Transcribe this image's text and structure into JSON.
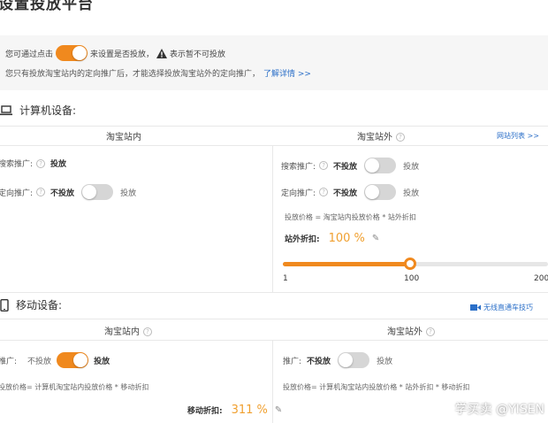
{
  "page_title": "设置投放平台",
  "notice": {
    "line1_prefix": "您可通过点击",
    "line1_mid": "来设置是否投放，",
    "line1_suffix": "表示暂不可投放",
    "line2": "您只有投放淘宝站内的定向推广后，才能选择投放淘宝站外的定向推广，",
    "link": "了解详情 >>"
  },
  "computer": {
    "title": "计算机设备:",
    "inside_header": "淘宝站内",
    "outside_header": "淘宝站外",
    "site_list_link": "网站列表 >>",
    "inside_rows": [
      {
        "label": "搜索推广:",
        "state": "投放"
      },
      {
        "label": "定向推广:",
        "state": "不投放",
        "option": "投放"
      }
    ],
    "outside_rows": [
      {
        "label": "搜索推广:",
        "state": "不投放",
        "option": "投放"
      },
      {
        "label": "定向推广:",
        "state": "不投放",
        "option": "投放"
      }
    ],
    "formula": "投放价格 = 淘宝站内投放价格 * 站外折扣",
    "discount_label": "站外折扣:",
    "discount_value": "100 %",
    "slider": {
      "min_label": "1",
      "mid_label": "100",
      "max_label": "200",
      "value": 100,
      "min": 1,
      "max": 200
    }
  },
  "mobile": {
    "title": "移动设备:",
    "tips_link": "无线直通车技巧",
    "inside_header": "淘宝站内",
    "outside_header": "淘宝站外",
    "inside_row": {
      "label": "推广:",
      "state": "不投放",
      "after": "投放"
    },
    "outside_row": {
      "label": "推广:",
      "state": "不投放",
      "option": "投放"
    },
    "inside_formula": "投放价格= 计算机淘宝站内投放价格 * 移动折扣",
    "outside_formula": "投放价格= 计算机淘宝站内投放价格 * 站外折扣 * 移动折扣",
    "discount_label": "移动折扣:",
    "discount_value": "311 %"
  },
  "watermark": "学买卖 @YISEN",
  "colors": {
    "accent": "#f0891e",
    "link": "#2b6fc8",
    "value": "#f0a030"
  }
}
